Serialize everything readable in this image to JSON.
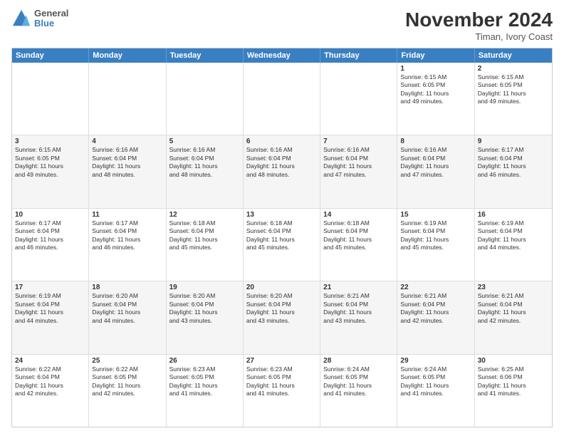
{
  "logo": {
    "line1": "General",
    "line2": "Blue"
  },
  "title": "November 2024",
  "location": "Timan, Ivory Coast",
  "days_of_week": [
    "Sunday",
    "Monday",
    "Tuesday",
    "Wednesday",
    "Thursday",
    "Friday",
    "Saturday"
  ],
  "weeks": [
    [
      {
        "day": "",
        "info": ""
      },
      {
        "day": "",
        "info": ""
      },
      {
        "day": "",
        "info": ""
      },
      {
        "day": "",
        "info": ""
      },
      {
        "day": "",
        "info": ""
      },
      {
        "day": "1",
        "info": "Sunrise: 6:15 AM\nSunset: 6:05 PM\nDaylight: 11 hours\nand 49 minutes."
      },
      {
        "day": "2",
        "info": "Sunrise: 6:15 AM\nSunset: 6:05 PM\nDaylight: 11 hours\nand 49 minutes."
      }
    ],
    [
      {
        "day": "3",
        "info": "Sunrise: 6:15 AM\nSunset: 6:05 PM\nDaylight: 11 hours\nand 49 minutes."
      },
      {
        "day": "4",
        "info": "Sunrise: 6:16 AM\nSunset: 6:04 PM\nDaylight: 11 hours\nand 48 minutes."
      },
      {
        "day": "5",
        "info": "Sunrise: 6:16 AM\nSunset: 6:04 PM\nDaylight: 11 hours\nand 48 minutes."
      },
      {
        "day": "6",
        "info": "Sunrise: 6:16 AM\nSunset: 6:04 PM\nDaylight: 11 hours\nand 48 minutes."
      },
      {
        "day": "7",
        "info": "Sunrise: 6:16 AM\nSunset: 6:04 PM\nDaylight: 11 hours\nand 47 minutes."
      },
      {
        "day": "8",
        "info": "Sunrise: 6:16 AM\nSunset: 6:04 PM\nDaylight: 11 hours\nand 47 minutes."
      },
      {
        "day": "9",
        "info": "Sunrise: 6:17 AM\nSunset: 6:04 PM\nDaylight: 11 hours\nand 46 minutes."
      }
    ],
    [
      {
        "day": "10",
        "info": "Sunrise: 6:17 AM\nSunset: 6:04 PM\nDaylight: 11 hours\nand 46 minutes."
      },
      {
        "day": "11",
        "info": "Sunrise: 6:17 AM\nSunset: 6:04 PM\nDaylight: 11 hours\nand 46 minutes."
      },
      {
        "day": "12",
        "info": "Sunrise: 6:18 AM\nSunset: 6:04 PM\nDaylight: 11 hours\nand 45 minutes."
      },
      {
        "day": "13",
        "info": "Sunrise: 6:18 AM\nSunset: 6:04 PM\nDaylight: 11 hours\nand 45 minutes."
      },
      {
        "day": "14",
        "info": "Sunrise: 6:18 AM\nSunset: 6:04 PM\nDaylight: 11 hours\nand 45 minutes."
      },
      {
        "day": "15",
        "info": "Sunrise: 6:19 AM\nSunset: 6:04 PM\nDaylight: 11 hours\nand 45 minutes."
      },
      {
        "day": "16",
        "info": "Sunrise: 6:19 AM\nSunset: 6:04 PM\nDaylight: 11 hours\nand 44 minutes."
      }
    ],
    [
      {
        "day": "17",
        "info": "Sunrise: 6:19 AM\nSunset: 6:04 PM\nDaylight: 11 hours\nand 44 minutes."
      },
      {
        "day": "18",
        "info": "Sunrise: 6:20 AM\nSunset: 6:04 PM\nDaylight: 11 hours\nand 44 minutes."
      },
      {
        "day": "19",
        "info": "Sunrise: 6:20 AM\nSunset: 6:04 PM\nDaylight: 11 hours\nand 43 minutes."
      },
      {
        "day": "20",
        "info": "Sunrise: 6:20 AM\nSunset: 6:04 PM\nDaylight: 11 hours\nand 43 minutes."
      },
      {
        "day": "21",
        "info": "Sunrise: 6:21 AM\nSunset: 6:04 PM\nDaylight: 11 hours\nand 43 minutes."
      },
      {
        "day": "22",
        "info": "Sunrise: 6:21 AM\nSunset: 6:04 PM\nDaylight: 11 hours\nand 42 minutes."
      },
      {
        "day": "23",
        "info": "Sunrise: 6:21 AM\nSunset: 6:04 PM\nDaylight: 11 hours\nand 42 minutes."
      }
    ],
    [
      {
        "day": "24",
        "info": "Sunrise: 6:22 AM\nSunset: 6:04 PM\nDaylight: 11 hours\nand 42 minutes."
      },
      {
        "day": "25",
        "info": "Sunrise: 6:22 AM\nSunset: 6:05 PM\nDaylight: 11 hours\nand 42 minutes."
      },
      {
        "day": "26",
        "info": "Sunrise: 6:23 AM\nSunset: 6:05 PM\nDaylight: 11 hours\nand 41 minutes."
      },
      {
        "day": "27",
        "info": "Sunrise: 6:23 AM\nSunset: 6:05 PM\nDaylight: 11 hours\nand 41 minutes."
      },
      {
        "day": "28",
        "info": "Sunrise: 6:24 AM\nSunset: 6:05 PM\nDaylight: 11 hours\nand 41 minutes."
      },
      {
        "day": "29",
        "info": "Sunrise: 6:24 AM\nSunset: 6:05 PM\nDaylight: 11 hours\nand 41 minutes."
      },
      {
        "day": "30",
        "info": "Sunrise: 6:25 AM\nSunset: 6:06 PM\nDaylight: 11 hours\nand 41 minutes."
      }
    ]
  ]
}
